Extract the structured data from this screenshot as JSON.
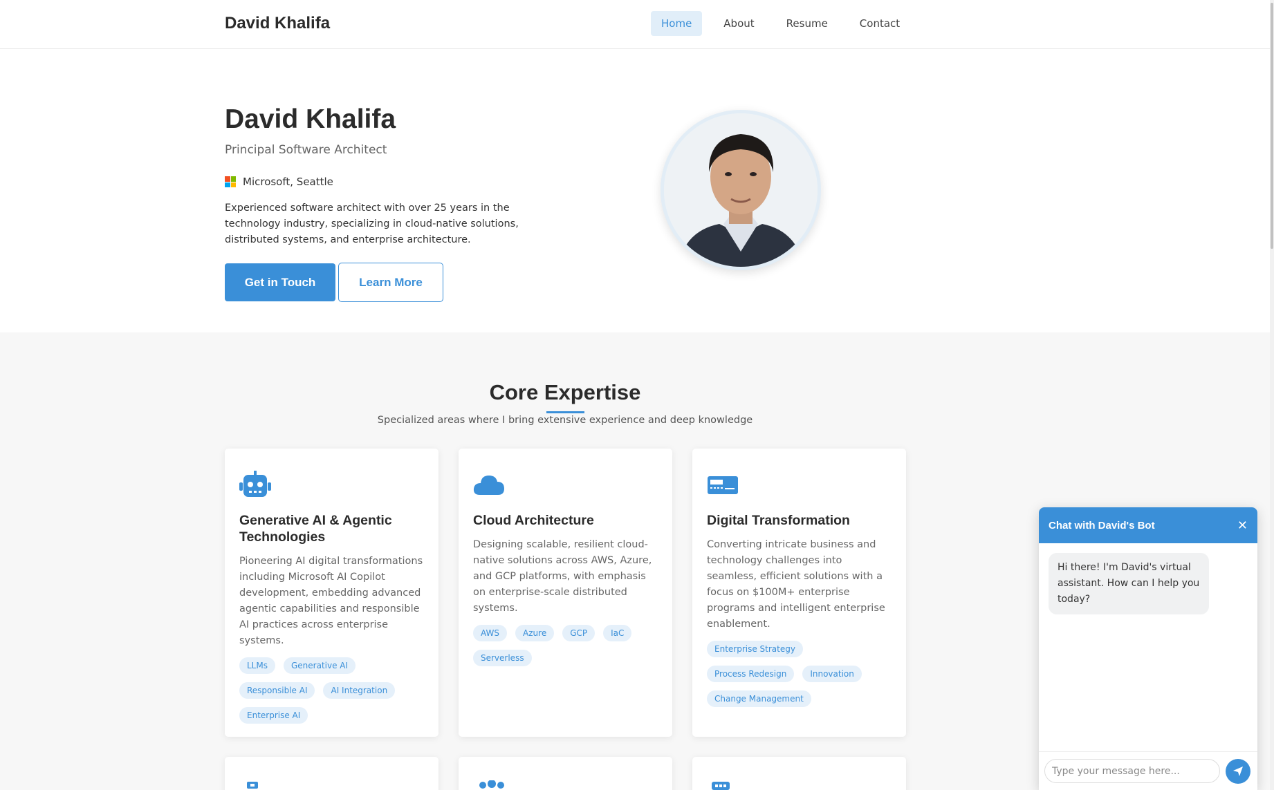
{
  "header": {
    "brand": "David Khalifa",
    "nav": [
      {
        "label": "Home",
        "active": true
      },
      {
        "label": "About",
        "active": false
      },
      {
        "label": "Resume",
        "active": false
      },
      {
        "label": "Contact",
        "active": false
      }
    ]
  },
  "hero": {
    "name": "David Khalifa",
    "title": "Principal Software Architect",
    "company": "Microsoft, Seattle",
    "description": "Experienced software architect with over 25 years in the technology industry, specializing in cloud-native solutions, distributed systems, and enterprise architecture.",
    "primary_button": "Get in Touch",
    "secondary_button": "Learn More"
  },
  "expertise": {
    "title": "Core Expertise",
    "subtitle": "Specialized areas where I bring extensive experience and deep knowledge",
    "cards": [
      {
        "icon": "robot-icon",
        "title": "Generative AI & Agentic Technologies",
        "description": "Pioneering AI digital transformations including Microsoft AI Copilot development, embedding advanced agentic capabilities and responsible AI practices across enterprise systems.",
        "tags": [
          "LLMs",
          "Generative AI",
          "Responsible AI",
          "AI Integration",
          "Enterprise AI"
        ]
      },
      {
        "icon": "cloud-icon",
        "title": "Cloud Architecture",
        "description": "Designing scalable, resilient cloud-native solutions across AWS, Azure, and GCP platforms, with emphasis on enterprise-scale distributed systems.",
        "tags": [
          "AWS",
          "Azure",
          "GCP",
          "IaC",
          "Serverless"
        ]
      },
      {
        "icon": "card-icon",
        "title": "Digital Transformation",
        "description": "Converting intricate business and technology challenges into seamless, efficient solutions with a focus on $100M+ enterprise programs and intelligent enterprise enablement.",
        "tags": [
          "Enterprise Strategy",
          "Process Redesign",
          "Innovation",
          "Change Management"
        ]
      }
    ],
    "partial_cards": [
      {
        "icon": "network-icon"
      },
      {
        "icon": "team-icon"
      },
      {
        "icon": "chat-dots-icon"
      }
    ]
  },
  "chat": {
    "title": "Chat with David's Bot",
    "greeting": "Hi there! I'm David's virtual assistant. How can I help you today?",
    "input_placeholder": "Type your message here..."
  },
  "colors": {
    "accent": "#3a8fd8",
    "tag_bg": "#e5f0fa",
    "nav_active_bg": "#e1eef9"
  }
}
